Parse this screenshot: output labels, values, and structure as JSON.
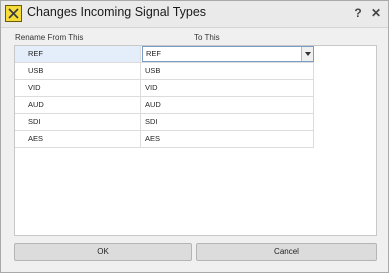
{
  "window": {
    "title": "Changes Incoming Signal Types",
    "help_label": "?",
    "close_label": "✕"
  },
  "columns": {
    "from_label": "Rename From This",
    "to_label": "To This"
  },
  "rows": [
    {
      "from": "REF",
      "to": "REF"
    },
    {
      "from": "USB",
      "to": "USB"
    },
    {
      "from": "VID",
      "to": "VID"
    },
    {
      "from": "AUD",
      "to": "AUD"
    },
    {
      "from": "SDI",
      "to": "SDI"
    },
    {
      "from": "AES",
      "to": "AES"
    }
  ],
  "buttons": {
    "ok_label": "OK",
    "cancel_label": "Cancel"
  },
  "icons": {
    "app": "app-icon",
    "dropdown": "chevron-down-icon"
  }
}
